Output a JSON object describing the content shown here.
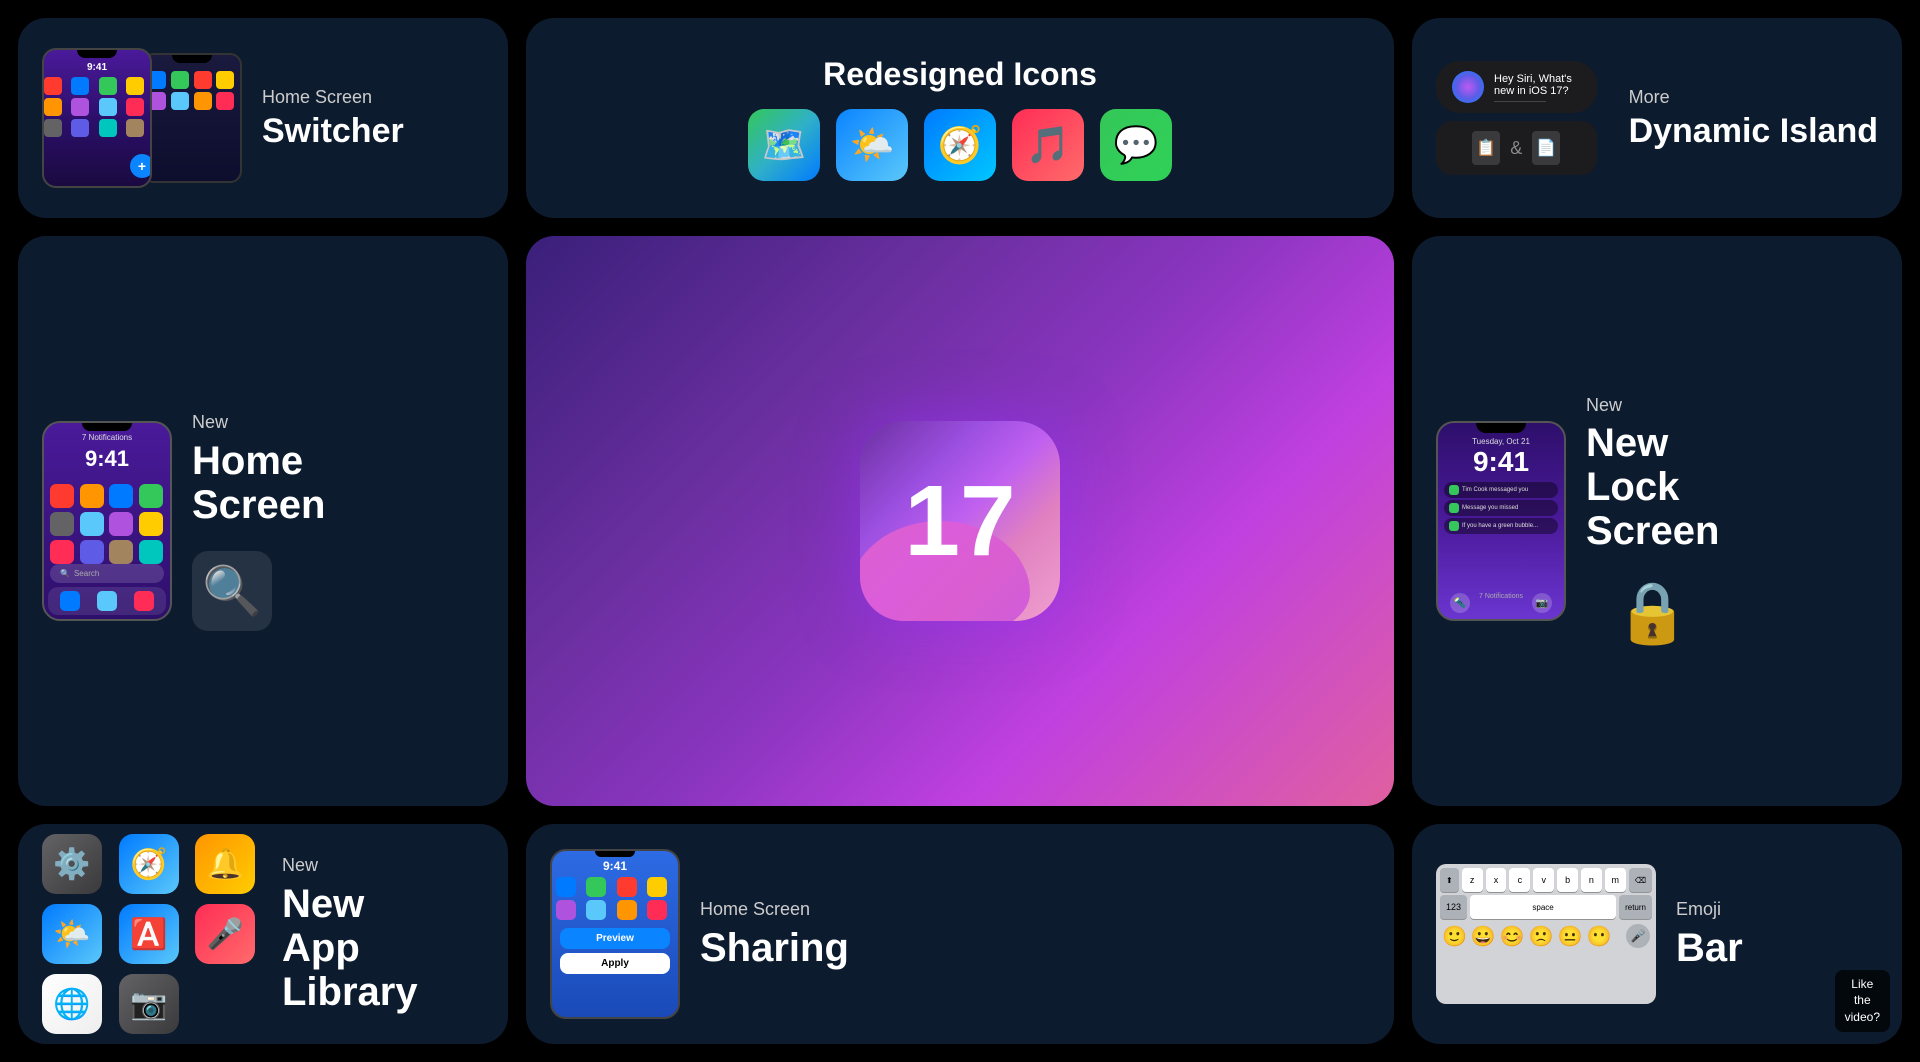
{
  "page": {
    "background": "#000000"
  },
  "cards": {
    "home_switcher": {
      "label": "Home Screen",
      "title": "Switcher",
      "time": "9:41"
    },
    "redesigned_icons": {
      "title": "Redesigned Icons",
      "icons": [
        "maps",
        "weather",
        "safari",
        "music",
        "messages"
      ]
    },
    "dynamic_island": {
      "label": "More",
      "title": "Dynamic Island",
      "siri_text": "Hey Siri, What's new in iOS 17?"
    },
    "new_home_screen": {
      "label": "New",
      "title": "Home Screen",
      "time": "9:41",
      "notification": "7 Notifications",
      "search_placeholder": "Search"
    },
    "ios17_hero": {
      "number": "17"
    },
    "new_lock_screen": {
      "label": "New",
      "title": "Lock Screen",
      "date": "Tuesday, Oct 21",
      "time": "9:41",
      "notifications_count": "7 Notifications"
    },
    "app_library": {
      "label": "New",
      "title": "App Library"
    },
    "home_sharing": {
      "label": "Home Screen",
      "title": "Sharing",
      "time": "9:41",
      "preview_label": "Preview",
      "apply_label": "Apply"
    },
    "emoji_bar": {
      "label": "Emoji",
      "title": "Bar",
      "keys_row1": [
        "z",
        "x",
        "c",
        "v",
        "b",
        "n",
        "m"
      ],
      "space_label": "space",
      "return_label": "return",
      "number_label": "123",
      "emojis": [
        "🙂",
        "😀",
        "😊",
        "🙁",
        "😐",
        "😶"
      ],
      "like_badge_line1": "Like",
      "like_badge_line2": "the",
      "like_badge_line3": "video?"
    }
  }
}
